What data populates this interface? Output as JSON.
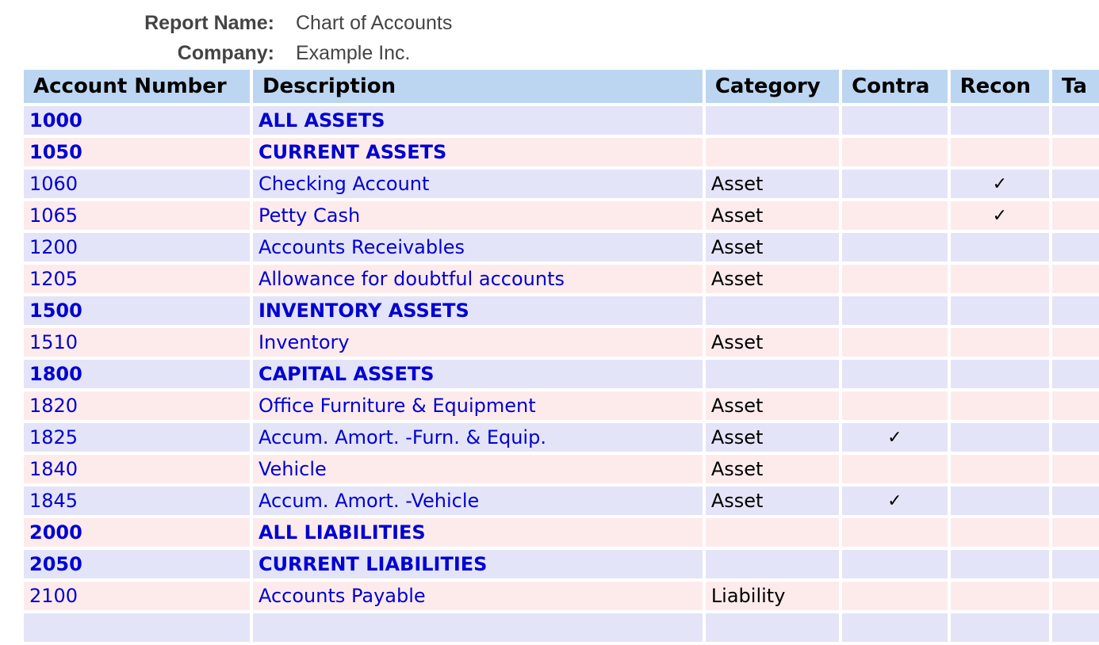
{
  "header": {
    "report_name_label": "Report Name:",
    "report_name": "Chart of Accounts",
    "company_label": "Company:",
    "company": "Example Inc."
  },
  "table": {
    "columns": [
      "Account Number",
      "Description",
      "Category",
      "Contra",
      "Recon",
      "Ta"
    ],
    "rows": [
      {
        "number": "1000",
        "description": "ALL ASSETS",
        "category": "",
        "contra": "",
        "recon": "",
        "heading": true
      },
      {
        "number": "1050",
        "description": "CURRENT ASSETS",
        "category": "",
        "contra": "",
        "recon": "",
        "heading": true
      },
      {
        "number": "1060",
        "description": "Checking Account",
        "category": "Asset",
        "contra": "",
        "recon": "✓",
        "heading": false
      },
      {
        "number": "1065",
        "description": "Petty Cash",
        "category": "Asset",
        "contra": "",
        "recon": "✓",
        "heading": false
      },
      {
        "number": "1200",
        "description": "Accounts Receivables",
        "category": "Asset",
        "contra": "",
        "recon": "",
        "heading": false
      },
      {
        "number": "1205",
        "description": "Allowance for doubtful accounts",
        "category": "Asset",
        "contra": "",
        "recon": "",
        "heading": false
      },
      {
        "number": "1500",
        "description": "INVENTORY ASSETS",
        "category": "",
        "contra": "",
        "recon": "",
        "heading": true
      },
      {
        "number": "1510",
        "description": "Inventory",
        "category": "Asset",
        "contra": "",
        "recon": "",
        "heading": false
      },
      {
        "number": "1800",
        "description": "CAPITAL ASSETS",
        "category": "",
        "contra": "",
        "recon": "",
        "heading": true
      },
      {
        "number": "1820",
        "description": "Office Furniture & Equipment",
        "category": "Asset",
        "contra": "",
        "recon": "",
        "heading": false
      },
      {
        "number": "1825",
        "description": "Accum. Amort. -Furn. & Equip.",
        "category": "Asset",
        "contra": "✓",
        "recon": "",
        "heading": false
      },
      {
        "number": "1840",
        "description": "Vehicle",
        "category": "Asset",
        "contra": "",
        "recon": "",
        "heading": false
      },
      {
        "number": "1845",
        "description": "Accum. Amort. -Vehicle",
        "category": "Asset",
        "contra": "✓",
        "recon": "",
        "heading": false
      },
      {
        "number": "2000",
        "description": "ALL LIABILITIES",
        "category": "",
        "contra": "",
        "recon": "",
        "heading": true
      },
      {
        "number": "2050",
        "description": "CURRENT LIABILITIES",
        "category": "",
        "contra": "",
        "recon": "",
        "heading": true
      },
      {
        "number": "2100",
        "description": "Accounts Payable",
        "category": "Liability",
        "contra": "",
        "recon": "",
        "heading": false
      },
      {
        "number": "",
        "description": "",
        "category": "",
        "contra": "",
        "recon": "",
        "heading": false
      }
    ]
  },
  "colors": {
    "header_bg": "#bcd6f1",
    "row_even_bg": "#e4e4f8",
    "row_odd_bg": "#fdebec",
    "link_color": "#0000d4"
  }
}
